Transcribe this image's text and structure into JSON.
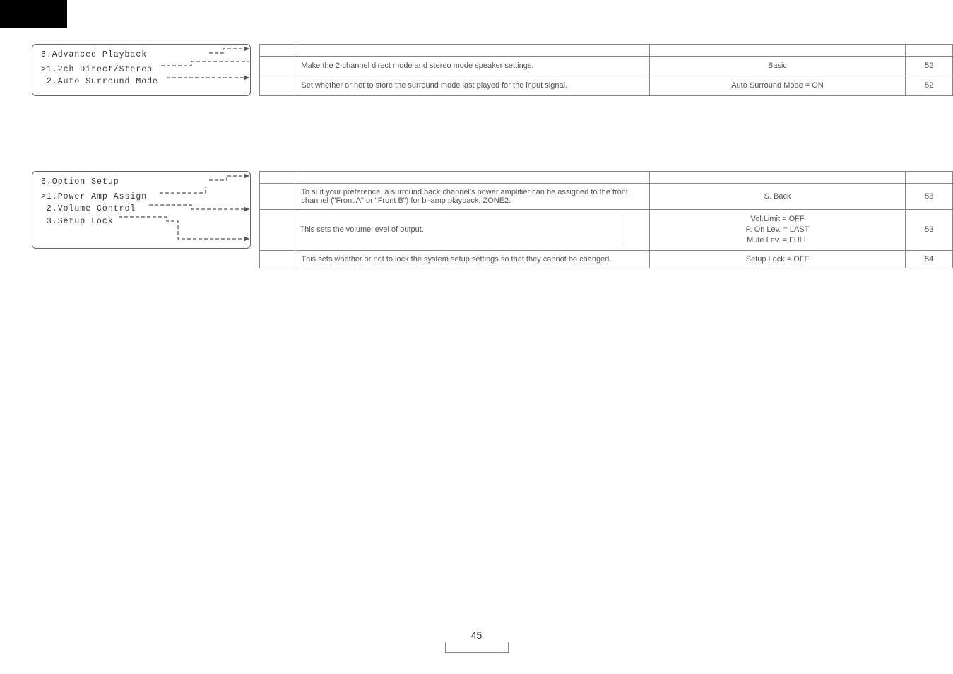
{
  "section1": {
    "lcd": {
      "title": "5.Advanced Playback",
      "line1": ">1.2ch Direct/Stereo",
      "line2": " 2.Auto Surround Mode"
    },
    "rows": [
      {
        "desc": "Make the 2-channel direct mode and stereo mode speaker settings.",
        "def": "Basic",
        "page": "52"
      },
      {
        "desc": "Set whether or not to store the surround mode last played for the input signal.",
        "def": "Auto Surround Mode = ON",
        "page": "52"
      }
    ]
  },
  "section2": {
    "lcd": {
      "title": "6.Option Setup",
      "line1": ">1.Power Amp Assign",
      "line2": " 2.Volume Control",
      "line3": " 3.Setup Lock"
    },
    "rows": [
      {
        "desc": "To suit your preference, a surround back channel's power amplifier can be assigned to the front channel (\"Front A\" or \"Front B\") for bi-amp playback, ZONE2.",
        "def": "S. Back",
        "page": "53"
      },
      {
        "desc": "This sets the volume level of output.",
        "def_lines": [
          "Vol.Limit = OFF",
          "P. On Lev. = LAST",
          "Mute Lev. = FULL"
        ],
        "page": "53"
      },
      {
        "desc": "This sets whether or not to lock the system setup settings so that they cannot be changed.",
        "def": "Setup Lock = OFF",
        "page": "54"
      }
    ]
  },
  "page_number": "45"
}
